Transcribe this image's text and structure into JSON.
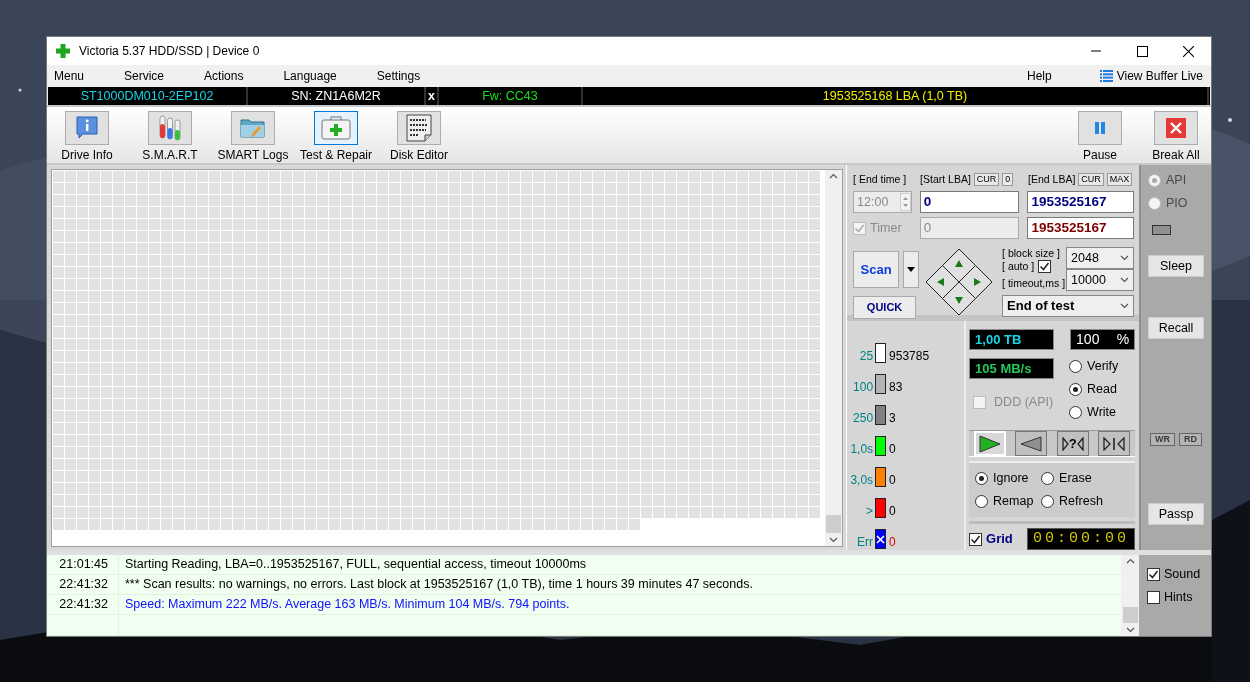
{
  "window": {
    "title": "Victoria 5.37 HDD/SSD | Device 0"
  },
  "menu": [
    {
      "label": "Menu"
    },
    {
      "label": "Service"
    },
    {
      "label": "Actions"
    },
    {
      "label": "Language"
    },
    {
      "label": "Settings"
    }
  ],
  "menu_right": {
    "help": "Help",
    "buffer": "View Buffer Live"
  },
  "drive_bar": {
    "model": "ST1000DM010-2EP102",
    "serial": "SN: ZN1A6M2R",
    "close": "x",
    "firmware": "Fw: CC43",
    "capacity": "1953525168 LBA (1,0 TB)"
  },
  "toolbar": [
    {
      "label": "Drive Info",
      "kind": "info",
      "selected": false
    },
    {
      "label": "S.M.A.R.T",
      "kind": "tubes",
      "selected": false
    },
    {
      "label": "SMART Logs",
      "kind": "folder",
      "selected": false
    },
    {
      "label": "Test & Repair",
      "kind": "kit",
      "selected": true
    },
    {
      "label": "Disk Editor",
      "kind": "hex",
      "selected": false
    }
  ],
  "toolbar_right": [
    {
      "label": "Pause",
      "kind": "pause"
    },
    {
      "label": "Break All",
      "kind": "stop"
    }
  ],
  "scan_settings": {
    "end_time_label": "[ End time ]",
    "start_lba_label": "[Start LBA]",
    "start_cur": "CUR",
    "start_zero": "0",
    "end_lba_label": "[End LBA]",
    "end_cur": "CUR",
    "end_max": "MAX",
    "end_time": "12:00",
    "start_lba": "0",
    "end_lba": "1953525167",
    "timer": {
      "label": "Timer",
      "checked": true,
      "disabled": true
    },
    "timer_start": "0",
    "timer_end": "1953525167",
    "scan_button": "Scan",
    "quick_button": "QUICK",
    "block_size_label": "[ block size ]",
    "auto_label": "[ auto ]",
    "auto_checked": true,
    "block_size": "2048",
    "timeout_label": "[ timeout,ms ]",
    "timeout": "10000",
    "end_action": "End of test"
  },
  "legend": [
    {
      "label": "25",
      "color": "#ffffff",
      "count": "953785",
      "kind": "time"
    },
    {
      "label": "100",
      "color": "#b4b4b4",
      "count": "83",
      "kind": "time"
    },
    {
      "label": "250",
      "color": "#808080",
      "count": "3",
      "kind": "time"
    },
    {
      "label": "1,0s",
      "color": "#00ff00",
      "count": "0",
      "kind": "time"
    },
    {
      "label": "3,0s",
      "color": "#ff8000",
      "count": "0",
      "kind": "time"
    },
    {
      "label": ">",
      "color": "#ff0000",
      "count": "0",
      "kind": "time"
    },
    {
      "label": "Err",
      "color": "#0000ff",
      "count": "0",
      "kind": "error"
    }
  ],
  "status": {
    "size": "1,00 TB",
    "percent": "100",
    "percent_unit": "%",
    "speed": "105 MB/s",
    "ddd": {
      "label": "DDD (API)",
      "checked": false,
      "disabled": true
    }
  },
  "modes": [
    {
      "label": "Verify",
      "selected": false
    },
    {
      "label": "Read",
      "selected": true
    },
    {
      "label": "Write",
      "selected": false
    }
  ],
  "direction_buttons": [
    {
      "kind": "play",
      "selected": true
    },
    {
      "kind": "back",
      "selected": false
    },
    {
      "kind": "query",
      "label": "?",
      "selected": false
    },
    {
      "kind": "end",
      "selected": false
    }
  ],
  "actions": [
    {
      "label": "Ignore",
      "selected": true
    },
    {
      "label": "Erase",
      "selected": false
    },
    {
      "label": "Remap",
      "selected": false
    },
    {
      "label": "Refresh",
      "selected": false
    }
  ],
  "grid": {
    "label": "Grid",
    "checked": true
  },
  "timer_display": "00:00:00",
  "side_panel": {
    "interfaces": [
      {
        "label": "API",
        "selected": true,
        "disabled": true
      },
      {
        "label": "PIO",
        "selected": false,
        "disabled": true
      }
    ],
    "buttons_top": [
      "Sleep",
      "Recall"
    ],
    "indicators": [
      "WR",
      "RD"
    ],
    "buttons_bottom": [
      "Passp"
    ]
  },
  "log": [
    {
      "time": "21:01:45",
      "text": "Starting Reading, LBA=0..1953525167, FULL, sequential access, timeout 10000ms",
      "kind": "info"
    },
    {
      "time": "22:41:32",
      "text": "*** Scan results: no warnings, no errors. Last block at 1953525167 (1,0 TB), time 1 hours 39 minutes 47 seconds.",
      "kind": "info"
    },
    {
      "time": "22:41:32",
      "text": "Speed: Maximum 222 MB/s. Average 163 MB/s. Minimum 104 MB/s. 794 points.",
      "kind": "speed"
    }
  ],
  "options": [
    {
      "label": "Sound",
      "checked": true
    },
    {
      "label": "Hints",
      "checked": false
    }
  ]
}
